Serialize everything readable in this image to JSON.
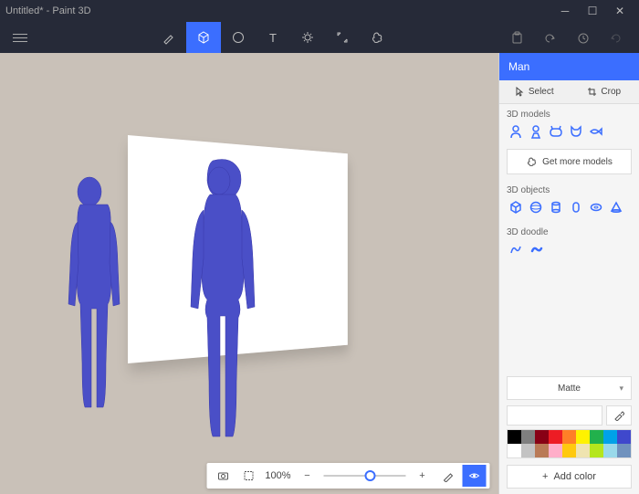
{
  "title": "Untitled* - Paint 3D",
  "sidebar": {
    "header": "Man",
    "tab_select": "Select",
    "tab_crop": "Crop",
    "section_models": "3D models",
    "get_more": "Get more models",
    "section_objects": "3D objects",
    "section_doodle": "3D doodle",
    "finish": "Matte",
    "add_color": "Add color"
  },
  "zoom": {
    "value": "100%"
  },
  "palette": [
    "#000000",
    "#7f7f7f",
    "#880015",
    "#ed1c24",
    "#ff7f27",
    "#fff200",
    "#22b14c",
    "#00a2e8",
    "#3f48cc",
    "#ffffff",
    "#c3c3c3",
    "#b97a57",
    "#ffaec9",
    "#ffc90e",
    "#efe4b0",
    "#b5e61d",
    "#99d9ea",
    "#7092be"
  ]
}
